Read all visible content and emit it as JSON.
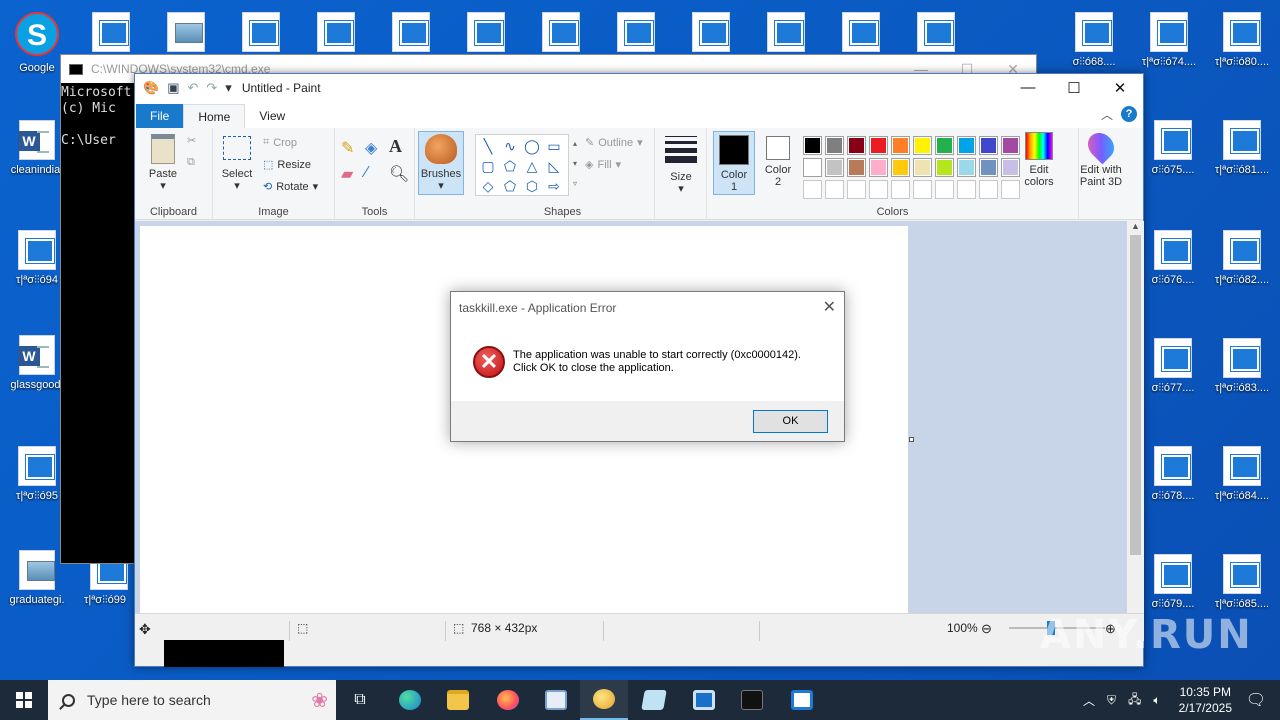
{
  "desktop": {
    "left_icons": [
      {
        "label": "Google",
        "kind": "skype",
        "badge": "S"
      },
      {
        "label": "cleanindia.",
        "kind": "word"
      },
      {
        "label": "τ|ªσ⫶⫶ó94",
        "kind": "doc"
      },
      {
        "label": "glassgood.",
        "kind": "word"
      },
      {
        "label": "τ|ªσ⫶⫶ó95",
        "kind": "doc"
      },
      {
        "label": "graduategi.",
        "kind": "image"
      }
    ],
    "second_col_labels": {
      "row1": "",
      "last": "τ|ªσ⫶⫶ó99"
    },
    "right_col_a": [
      "σ⫶⫶ó68....",
      "σ⫶⫶ó75....",
      "σ⫶⫶ó76....",
      "σ⫶⫶ó77....",
      "σ⫶⫶ó78....",
      "σ⫶⫶ó79...."
    ],
    "right_col_b": [
      "τ|ªσ⫶⫶ó74....",
      "τ|ªσ⫶⫶ó81....",
      "τ|ªσ⫶⫶ó82....",
      "τ|ªσ⫶⫶ó83....",
      "τ|ªσ⫶⫶ó84....",
      "τ|ªσ⫶⫶ó85...."
    ],
    "right_col_c": [
      "τ|ªσ⫶⫶ó80...."
    ]
  },
  "cmd": {
    "title": "C:\\WINDOWS\\system32\\cmd.exe",
    "line1": "Microsoft",
    "line2": "(c) Mic",
    "line3": "C:\\User"
  },
  "paint": {
    "title": "Untitled - Paint",
    "tabs": {
      "file": "File",
      "home": "Home",
      "view": "View"
    },
    "groups": {
      "clipboard": "Clipboard",
      "image": "Image",
      "tools": "Tools",
      "shapes": "Shapes",
      "colors": "Colors"
    },
    "buttons": {
      "paste": "Paste",
      "select": "Select",
      "crop": "Crop",
      "resize": "Resize",
      "rotate": "Rotate",
      "brushes": "Brushes",
      "outline": "Outline",
      "fill": "Fill",
      "size": "Size",
      "color1": "Color\n1",
      "color2": "Color\n2",
      "edit_colors": "Edit\ncolors",
      "edit_paint3d": "Edit with\nPaint 3D"
    },
    "palette_row1": [
      "#000000",
      "#7f7f7f",
      "#880015",
      "#ed1c24",
      "#ff7f27",
      "#fff200",
      "#22b14c",
      "#00a2e8",
      "#3f48cc",
      "#a349a4"
    ],
    "palette_row2": [
      "#ffffff",
      "#c3c3c3",
      "#b97a57",
      "#ffaec9",
      "#ffc90e",
      "#efe4b0",
      "#b5e61d",
      "#99d9ea",
      "#7092be",
      "#c8bfe7"
    ],
    "color1_value": "#000000",
    "color2_value": "#ffffff",
    "status": {
      "dimensions": "768 × 432px",
      "zoom": "100%"
    }
  },
  "dialog": {
    "title": "taskkill.exe - Application Error",
    "message_line1": "The application was unable to start correctly (0xc0000142).",
    "message_line2": "Click OK to close the application.",
    "ok": "OK"
  },
  "taskbar": {
    "search_placeholder": "Type here to search",
    "time": "10:35 PM",
    "date": "2/17/2025"
  },
  "watermark": "ANY.RUN"
}
